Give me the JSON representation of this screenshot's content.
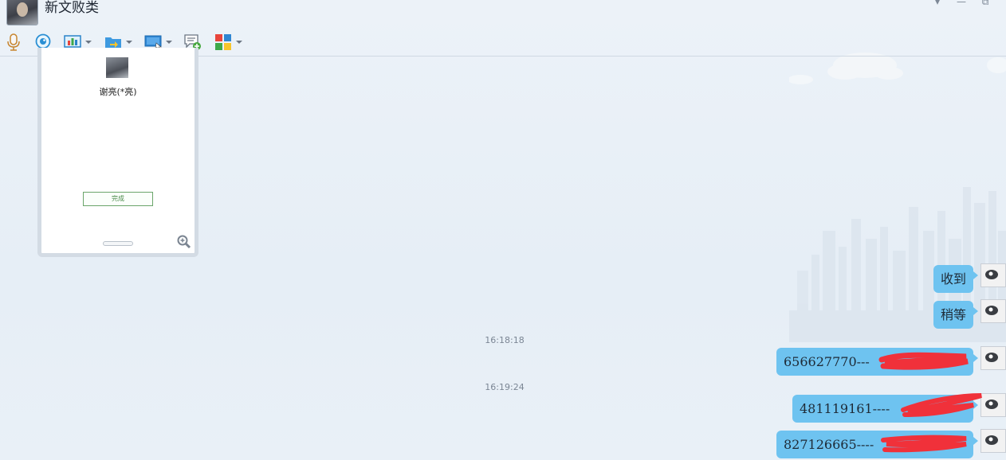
{
  "header": {
    "title": "新文败类",
    "window_controls": [
      "▾",
      "—",
      "⧉"
    ]
  },
  "toolbar": {
    "items": [
      {
        "name": "microphone-icon",
        "dropdown": false
      },
      {
        "name": "webcam-icon",
        "dropdown": false
      },
      {
        "name": "screen-share-icon",
        "dropdown": true
      },
      {
        "name": "folder-transfer-icon",
        "dropdown": true
      },
      {
        "name": "remote-desktop-icon",
        "dropdown": true
      },
      {
        "name": "add-message-icon",
        "dropdown": false
      },
      {
        "name": "apps-grid-icon",
        "dropdown": true
      }
    ]
  },
  "card": {
    "name": "谢亮(*亮)",
    "button_label": "完成"
  },
  "messages": [
    {
      "type": "bubble",
      "text": "收到"
    },
    {
      "type": "bubble",
      "text": "稍等"
    },
    {
      "type": "time",
      "text": "16:18:18"
    },
    {
      "type": "bubble",
      "text": "656627770---"
    },
    {
      "type": "time",
      "text": "16:19:24"
    },
    {
      "type": "bubble",
      "text": "481119161----"
    },
    {
      "type": "bubble",
      "text": "827126665----"
    }
  ],
  "colors": {
    "bubble": "#6ec3f0",
    "redaction": "#f0313a",
    "background": "#e9f0f7"
  }
}
